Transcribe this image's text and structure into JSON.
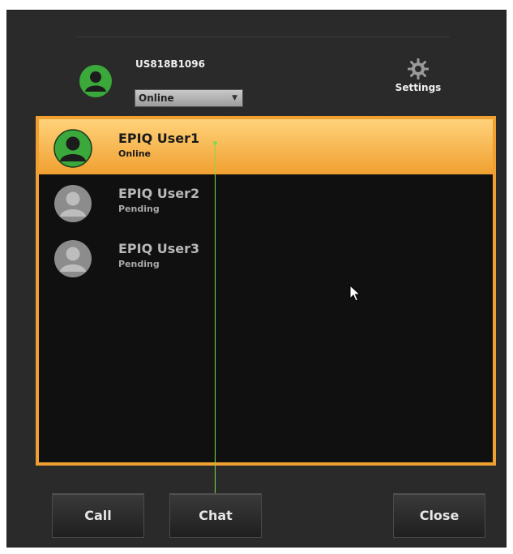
{
  "header": {
    "username": "US818B1096",
    "status_selected": "Online",
    "settings_label": "Settings"
  },
  "contacts": [
    {
      "name": "EPIQ User1",
      "status": "Online"
    },
    {
      "name": "EPIQ User2",
      "status": "Pending"
    },
    {
      "name": "EPIQ User3",
      "status": "Pending"
    }
  ],
  "buttons": {
    "call": "Call",
    "chat": "Chat",
    "close": "Close"
  },
  "colors": {
    "online": "#3aa83a",
    "pending": "#8c8c8c",
    "accent": "#f0a030",
    "annotation": "#7cde4a"
  },
  "icons": {
    "user": "user-avatar-icon",
    "settings": "gear-icon",
    "dropdown": "chevron-down-icon",
    "cursor": "mouse-cursor-icon"
  }
}
